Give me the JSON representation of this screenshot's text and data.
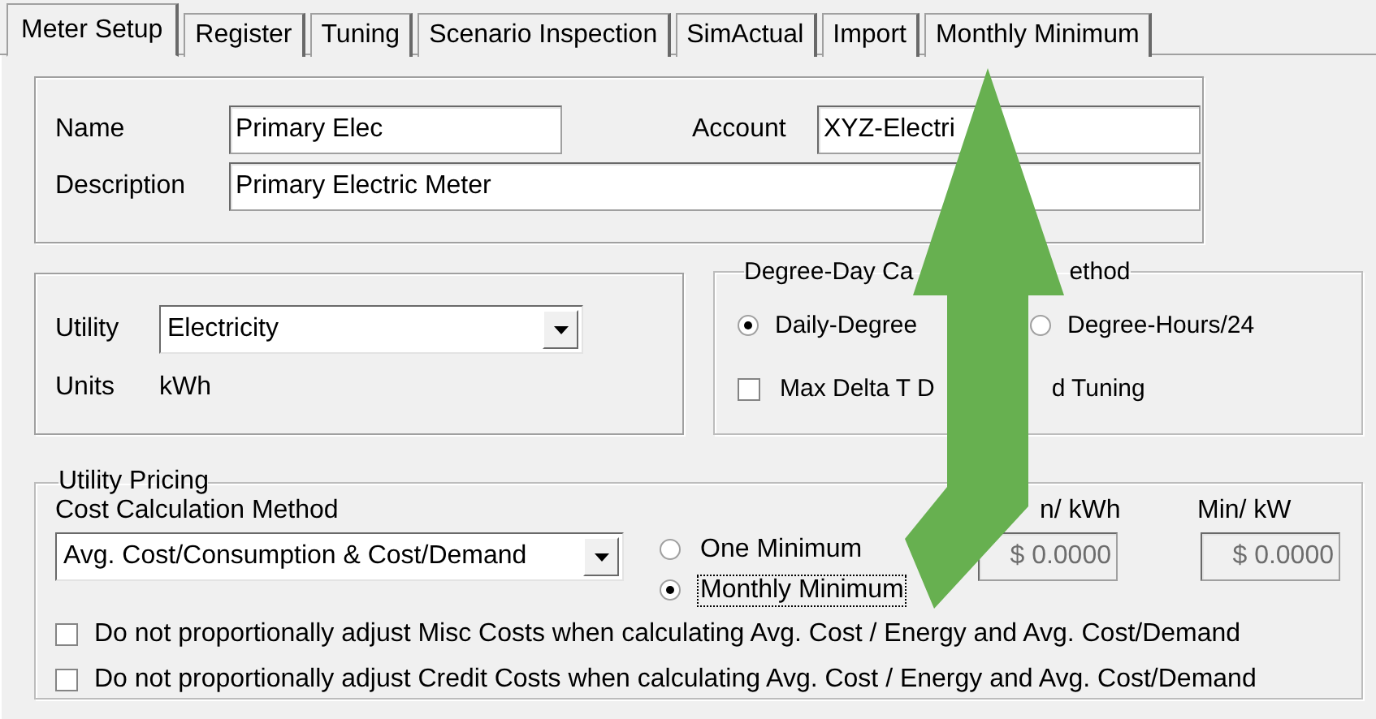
{
  "tabs": [
    {
      "label": "Meter Setup",
      "selected": true
    },
    {
      "label": "Register",
      "selected": false
    },
    {
      "label": "Tuning",
      "selected": false
    },
    {
      "label": "Scenario Inspection",
      "selected": false
    },
    {
      "label": "SimActual",
      "selected": false
    },
    {
      "label": "Import",
      "selected": false
    },
    {
      "label": "Monthly Minimum",
      "selected": false
    }
  ],
  "general": {
    "name": {
      "label": "Name",
      "value": "Primary Elec"
    },
    "account": {
      "label": "Account",
      "value": "XYZ-Electri"
    },
    "description": {
      "label": "Description",
      "value": "Primary Electric Meter"
    }
  },
  "utility": {
    "label": "Utility",
    "value": "Electricity",
    "units_label": "Units",
    "units": "kWh"
  },
  "degree_day": {
    "title_parts": [
      "Degree-Day Ca",
      "ethod"
    ],
    "options": [
      {
        "label": "Daily-Degree",
        "selected": true
      },
      {
        "label": "Degree-Hours/24",
        "selected": false
      }
    ],
    "tuning": {
      "label_parts": [
        "Max Delta T D",
        "d Tuning"
      ],
      "checked": false
    }
  },
  "pricing": {
    "title": "Utility Pricing",
    "method_label": "Cost Calculation Method",
    "method_value": "Avg. Cost/Consumption & Cost/Demand",
    "minimum_options": [
      {
        "label": "One Minimum",
        "selected": false,
        "focused": false
      },
      {
        "label": "Monthly Minimum",
        "selected": true,
        "focused": true
      }
    ],
    "min_kwh": {
      "label": "n/ kWh",
      "value": "$ 0.0000",
      "disabled": true
    },
    "min_kw": {
      "label": "Min/ kW",
      "value": "$ 0.0000",
      "disabled": true
    },
    "options": [
      {
        "label": "Do not proportionally adjust Misc Costs when calculating Avg. Cost / Energy and Avg. Cost/Demand",
        "checked": false
      },
      {
        "label": "Do not proportionally adjust Credit Costs when calculating Avg. Cost / Energy and Avg. Cost/Demand",
        "checked": false
      }
    ]
  }
}
